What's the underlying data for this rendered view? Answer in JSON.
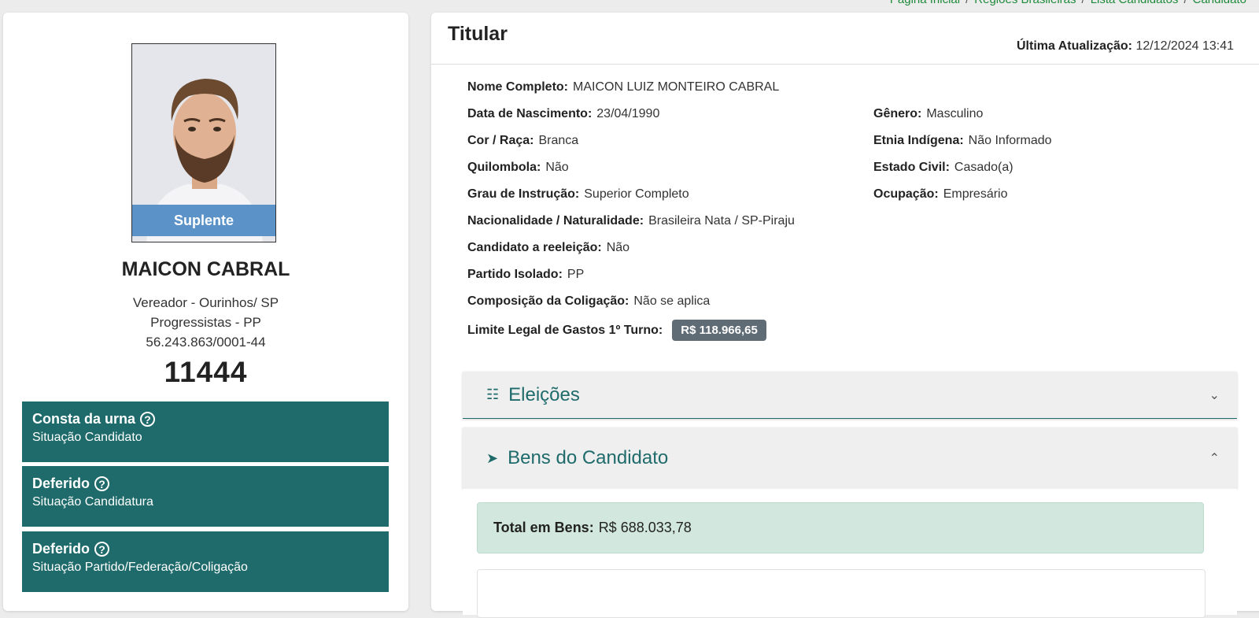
{
  "breadcrumb": {
    "items": [
      "Página Inicial",
      "Regiões Brasileiras",
      "Lista Candidatos",
      "Candidato"
    ],
    "separator": "/"
  },
  "candidate": {
    "photo_badge": "Suplente",
    "name": "MAICON CABRAL",
    "office": "Vereador - Ourinhos/ SP",
    "party": "Progressistas - PP",
    "cnpj": "56.243.863/0001-44",
    "number": "11444"
  },
  "status_boxes": [
    {
      "title": "Consta da urna",
      "subtitle": "Situação Candidato"
    },
    {
      "title": "Deferido",
      "subtitle": "Situação Candidatura"
    },
    {
      "title": "Deferido",
      "subtitle": "Situação Partido/Federação/Coligação"
    }
  ],
  "help_icon_glyph": "?",
  "titular": {
    "title": "Titular",
    "update_label": "Última Atualização:",
    "update_value": "12/12/2024 13:41"
  },
  "fields": {
    "nome": {
      "label": "Nome Completo:",
      "value": "MAICON LUIZ MONTEIRO CABRAL"
    },
    "nascimento": {
      "label": "Data de Nascimento:",
      "value": "23/04/1990"
    },
    "cor": {
      "label": "Cor / Raça:",
      "value": "Branca"
    },
    "quilombola": {
      "label": "Quilombola:",
      "value": "Não"
    },
    "instrucao": {
      "label": "Grau de Instrução:",
      "value": "Superior Completo"
    },
    "nacionalidade": {
      "label": "Nacionalidade / Naturalidade:",
      "value": "Brasileira Nata / SP-Piraju"
    },
    "reeleicao": {
      "label": "Candidato a reeleição:",
      "value": "Não"
    },
    "partido": {
      "label": "Partido Isolado:",
      "value": "PP"
    },
    "coligacao": {
      "label": "Composição da Coligação:",
      "value": "Não se aplica"
    },
    "limite": {
      "label": "Limite Legal de Gastos 1º Turno:",
      "value": "R$ 118.966,65"
    },
    "genero": {
      "label": "Gênero:",
      "value": "Masculino"
    },
    "etnia": {
      "label": "Etnia Indígena:",
      "value": "Não Informado"
    },
    "estado_civil": {
      "label": "Estado Civil:",
      "value": "Casado(a)"
    },
    "ocupacao": {
      "label": "Ocupação:",
      "value": "Empresário"
    }
  },
  "accordions": {
    "eleicoes": {
      "label": "Eleições",
      "icon": "sitemap-icon",
      "expanded": false
    },
    "bens": {
      "label": "Bens do Candidato",
      "icon": "rocket-icon",
      "expanded": true
    }
  },
  "bens": {
    "total_label": "Total em Bens:",
    "total_value": "R$ 688.033,78"
  },
  "colors": {
    "teal": "#1f6b6b",
    "badge_blue": "#5b93c9",
    "link_green": "#1f8a3b",
    "total_bg": "#d2e8df",
    "money_badge": "#5f6b75"
  }
}
